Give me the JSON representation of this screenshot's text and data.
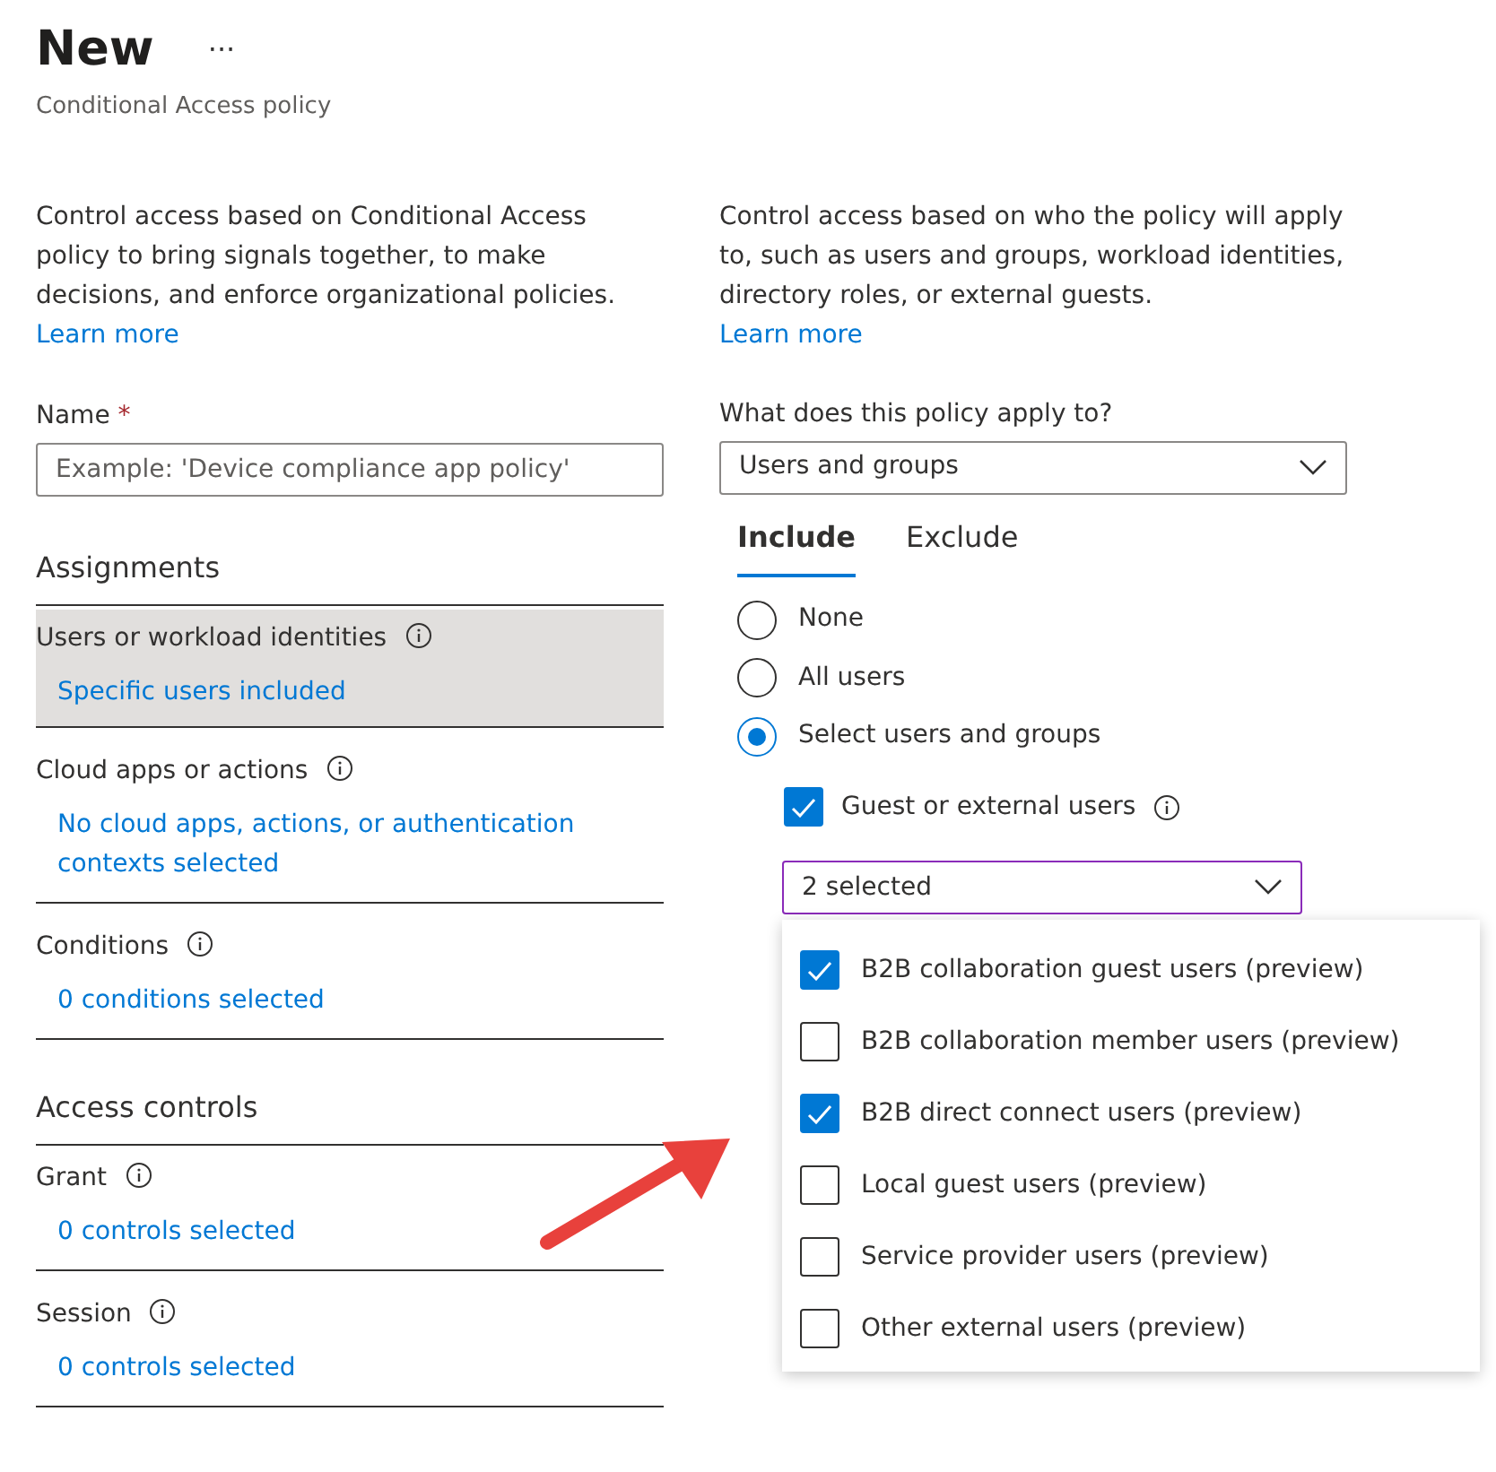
{
  "header": {
    "title": "New",
    "more": "···",
    "subtitle": "Conditional Access policy"
  },
  "left": {
    "description": "Control access based on Conditional Access policy to bring signals together, to make decisions, and enforce organizational policies.",
    "learn_more": "Learn more",
    "name_field": {
      "label": "Name",
      "required": "*",
      "placeholder": "Example: 'Device compliance app policy'"
    },
    "sections": [
      {
        "heading": "Assignments",
        "items": [
          {
            "label": "Users or workload identities",
            "info": true,
            "value": "Specific users included",
            "selected": true
          },
          {
            "label": "Cloud apps or actions",
            "info": true,
            "value": "No cloud apps, actions, or authentication contexts selected",
            "selected": false
          },
          {
            "label": "Conditions",
            "info": true,
            "value": "0 conditions selected",
            "selected": false
          }
        ]
      },
      {
        "heading": "Access controls",
        "items": [
          {
            "label": "Grant",
            "info": true,
            "value": "0 controls selected",
            "selected": false
          },
          {
            "label": "Session",
            "info": true,
            "value": "0 controls selected",
            "selected": false
          }
        ]
      }
    ]
  },
  "right": {
    "description": "Control access based on who the policy will apply to, such as users and groups, workload identities, directory roles, or external guests.",
    "learn_more": "Learn more",
    "apply_label": "What does this policy apply to?",
    "apply_value": "Users and groups",
    "tabs": [
      {
        "label": "Include",
        "selected": true
      },
      {
        "label": "Exclude",
        "selected": false
      }
    ],
    "radios": [
      {
        "label": "None",
        "selected": false
      },
      {
        "label": "All users",
        "selected": false
      },
      {
        "label": "Select users and groups",
        "selected": true
      }
    ],
    "guest_checkbox": {
      "label": "Guest or external users",
      "checked": true,
      "info": true
    },
    "multi_select": {
      "value": "2 selected",
      "expanded": true,
      "options": [
        {
          "label": "B2B collaboration guest users (preview)",
          "checked": true
        },
        {
          "label": "B2B collaboration member users (preview)",
          "checked": false
        },
        {
          "label": "B2B direct connect users (preview)",
          "checked": true
        },
        {
          "label": "Local guest users (preview)",
          "checked": false
        },
        {
          "label": "Service provider users (preview)",
          "checked": false
        },
        {
          "label": "Other external users (preview)",
          "checked": false
        }
      ]
    }
  }
}
